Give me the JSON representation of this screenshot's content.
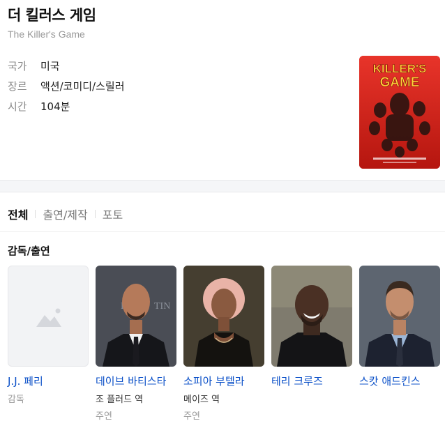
{
  "movie": {
    "title": "더 킬러스 게임",
    "original_title": "The Killer's Game",
    "info": [
      {
        "label": "국가",
        "value": "미국"
      },
      {
        "label": "장르",
        "value": "액션/코미디/스릴러"
      },
      {
        "label": "시간",
        "value": "104분"
      }
    ],
    "poster_title_line1": "KILLER'S",
    "poster_title_line2": "GAME"
  },
  "tabs": [
    {
      "label": "전체",
      "active": true
    },
    {
      "label": "출연/제작",
      "active": false
    },
    {
      "label": "포토",
      "active": false
    }
  ],
  "section": {
    "title": "감독/출연"
  },
  "cast": [
    {
      "name": "J.J. 페리",
      "role": "감독",
      "type": ""
    },
    {
      "name": "데이브 바티스타",
      "role": "조 플러드 역",
      "type": "주연"
    },
    {
      "name": "소피아 부텔라",
      "role": "메이즈 역",
      "type": "주연"
    },
    {
      "name": "테리 크루즈",
      "role": "",
      "type": ""
    },
    {
      "name": "스캇 애드킨스",
      "role": "",
      "type": ""
    }
  ],
  "colors": {
    "link": "#0b50c8",
    "poster_red": "#d9261c"
  }
}
